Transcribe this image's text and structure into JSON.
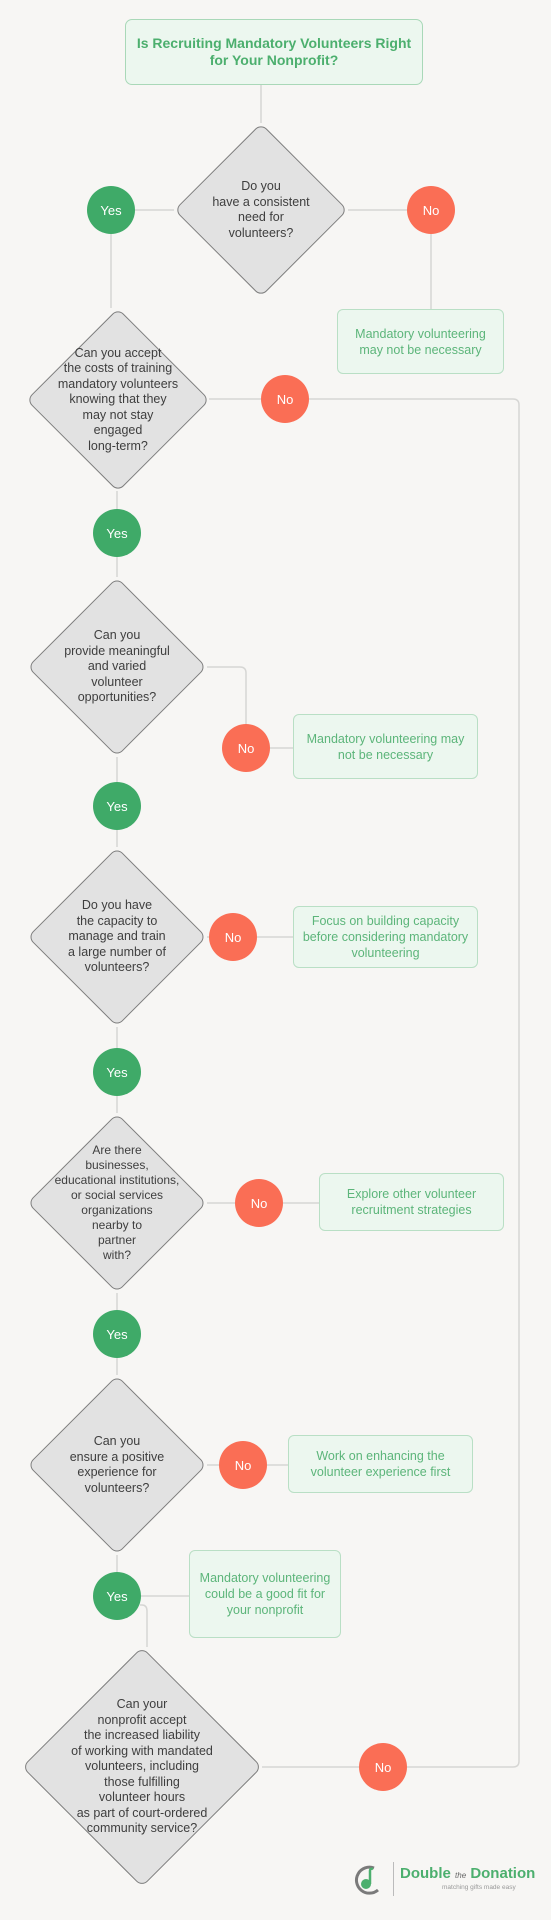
{
  "title": "Is Recruiting Mandatory Volunteers Right for Your Nonprofit?",
  "colors": {
    "yes": "#3faa68",
    "no": "#fa6e55",
    "outcome_text": "#5cb57a",
    "outcome_bg": "#ecf7ef",
    "diamond_fill": "#e2e2e2",
    "background": "#f7f6f4"
  },
  "labels": {
    "yes": "Yes",
    "no": "No"
  },
  "questions": [
    {
      "id": "q1",
      "text": "Do you\nhave a consistent\nneed for\nvolunteers?"
    },
    {
      "id": "q2",
      "text": "Can you accept\nthe costs of training\nmandatory volunteers\nknowing that they\nmay not stay\nengaged\nlong-term?"
    },
    {
      "id": "q3",
      "text": "Can you\nprovide meaningful\nand varied\nvolunteer\nopportunities?"
    },
    {
      "id": "q4",
      "text": "Do you have\nthe capacity to\nmanage and train\na large number of\nvolunteers?"
    },
    {
      "id": "q5",
      "text": "Are there\nbusinesses,\neducational institutions,\nor social services\norganizations\nnearby to\npartner\nwith?"
    },
    {
      "id": "q6",
      "text": "Can you\nensure a positive\nexperience for\nvolunteers?"
    },
    {
      "id": "q7",
      "text": "Can your\nnonprofit accept\nthe increased liability\nof working with mandated\nvolunteers, including\nthose fulfilling\nvolunteer hours\nas part of court-ordered\ncommunity service?"
    }
  ],
  "outcomes": [
    {
      "id": "o1",
      "text": "Mandatory volunteering may not be necessary"
    },
    {
      "id": "o3",
      "text": "Mandatory volunteering may not be necessary"
    },
    {
      "id": "o4",
      "text": "Focus on building capacity before considering mandatory volunteering"
    },
    {
      "id": "o5",
      "text": "Explore other volunteer recruitment strategies"
    },
    {
      "id": "o6",
      "text": "Work on enhancing the volunteer experience first"
    },
    {
      "id": "o7",
      "text": "Mandatory volunteering could be a good fit for your nonprofit"
    }
  ],
  "logo": {
    "brand_left": "Double",
    "brand_mid": "the",
    "brand_right": "Donation",
    "tagline": "matching gifts made easy"
  }
}
